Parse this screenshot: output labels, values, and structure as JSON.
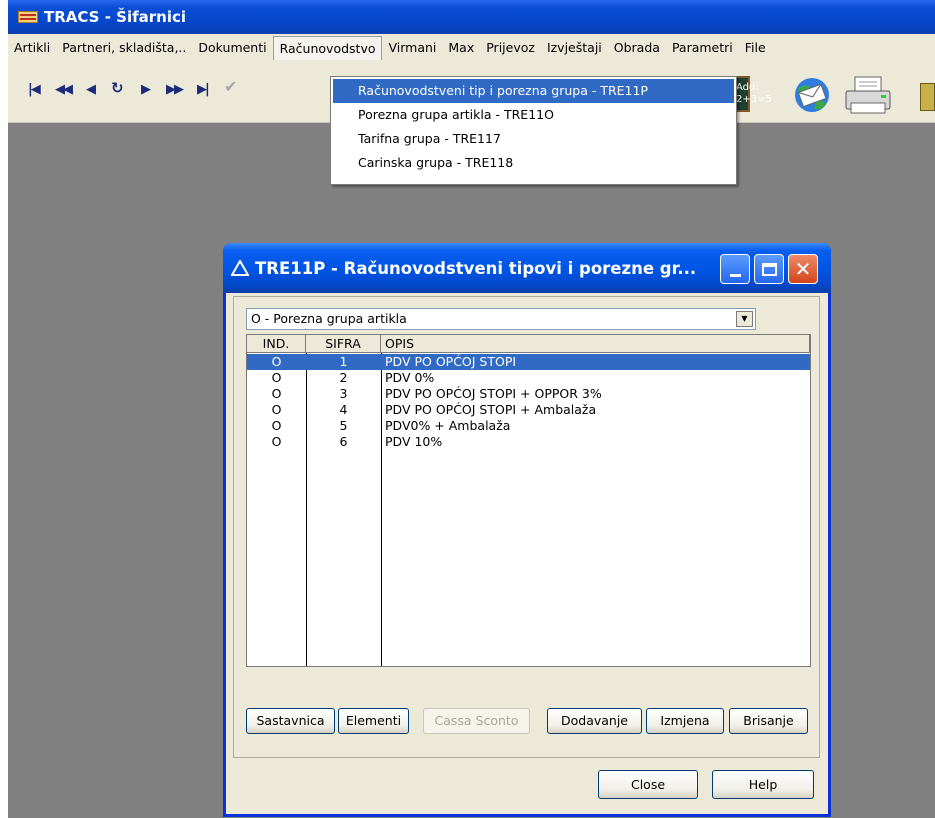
{
  "app": {
    "title": "TRACS - Šifarnici"
  },
  "menubar": {
    "items": [
      "Artikli",
      "Partneri, skladišta,..",
      "Dokumenti",
      "Računovodstvo",
      "Virmani",
      "Max",
      "Prijevoz",
      "Izvještaji",
      "Obrada",
      "Parametri",
      "File"
    ],
    "active": "Računovodstvo"
  },
  "toolbar": {
    "nav_buttons": [
      "first-record",
      "prev-page",
      "prev-record",
      "refresh",
      "next-record",
      "next-page",
      "last-record",
      "confirm"
    ],
    "calc_icon_text_top": "Add:",
    "calc_icon_text_bottom": "2+3=5"
  },
  "dropdown": {
    "items": [
      {
        "label": "Računovodstveni tip i porezna grupa - TRE11P",
        "selected": true
      },
      {
        "label": "Porezna grupa artikla - TRE11O",
        "selected": false
      },
      {
        "label": "Tarifna grupa - TRE117",
        "selected": false
      },
      {
        "label": "Carinska grupa - TRE118",
        "selected": false
      }
    ]
  },
  "dialog": {
    "title": "TRE11P - Računovodstveni tipovi i porezne gr...",
    "combo_value": "O - Porezna grupa artikla",
    "grid": {
      "columns": [
        "IND.",
        "SIFRA",
        "OPIS"
      ],
      "rows": [
        {
          "ind": "O",
          "sifra": "1",
          "opis": "PDV PO OPĆOJ STOPI",
          "selected": true
        },
        {
          "ind": "O",
          "sifra": "2",
          "opis": "PDV 0%",
          "selected": false
        },
        {
          "ind": "O",
          "sifra": "3",
          "opis": "PDV PO OPĆOJ STOPI + OPPOR 3%",
          "selected": false
        },
        {
          "ind": "O",
          "sifra": "4",
          "opis": "PDV PO OPĆOJ STOPI + Ambalaža",
          "selected": false
        },
        {
          "ind": "O",
          "sifra": "5",
          "opis": "PDV0% + Ambalaža",
          "selected": false
        },
        {
          "ind": "O",
          "sifra": "6",
          "opis": "PDV 10%",
          "selected": false
        }
      ]
    },
    "buttons": {
      "sastavnica": "Sastavnica",
      "elementi": "Elementi",
      "cassa_sconto": "Cassa Sconto",
      "dodavanje": "Dodavanje",
      "izmjena": "Izmjena",
      "brisanje": "Brisanje",
      "close": "Close",
      "help": "Help"
    }
  },
  "colors": {
    "selection": "#316ac5",
    "workspace": "#808080",
    "xp_title": "#0054e3",
    "face": "#ece9d8"
  }
}
